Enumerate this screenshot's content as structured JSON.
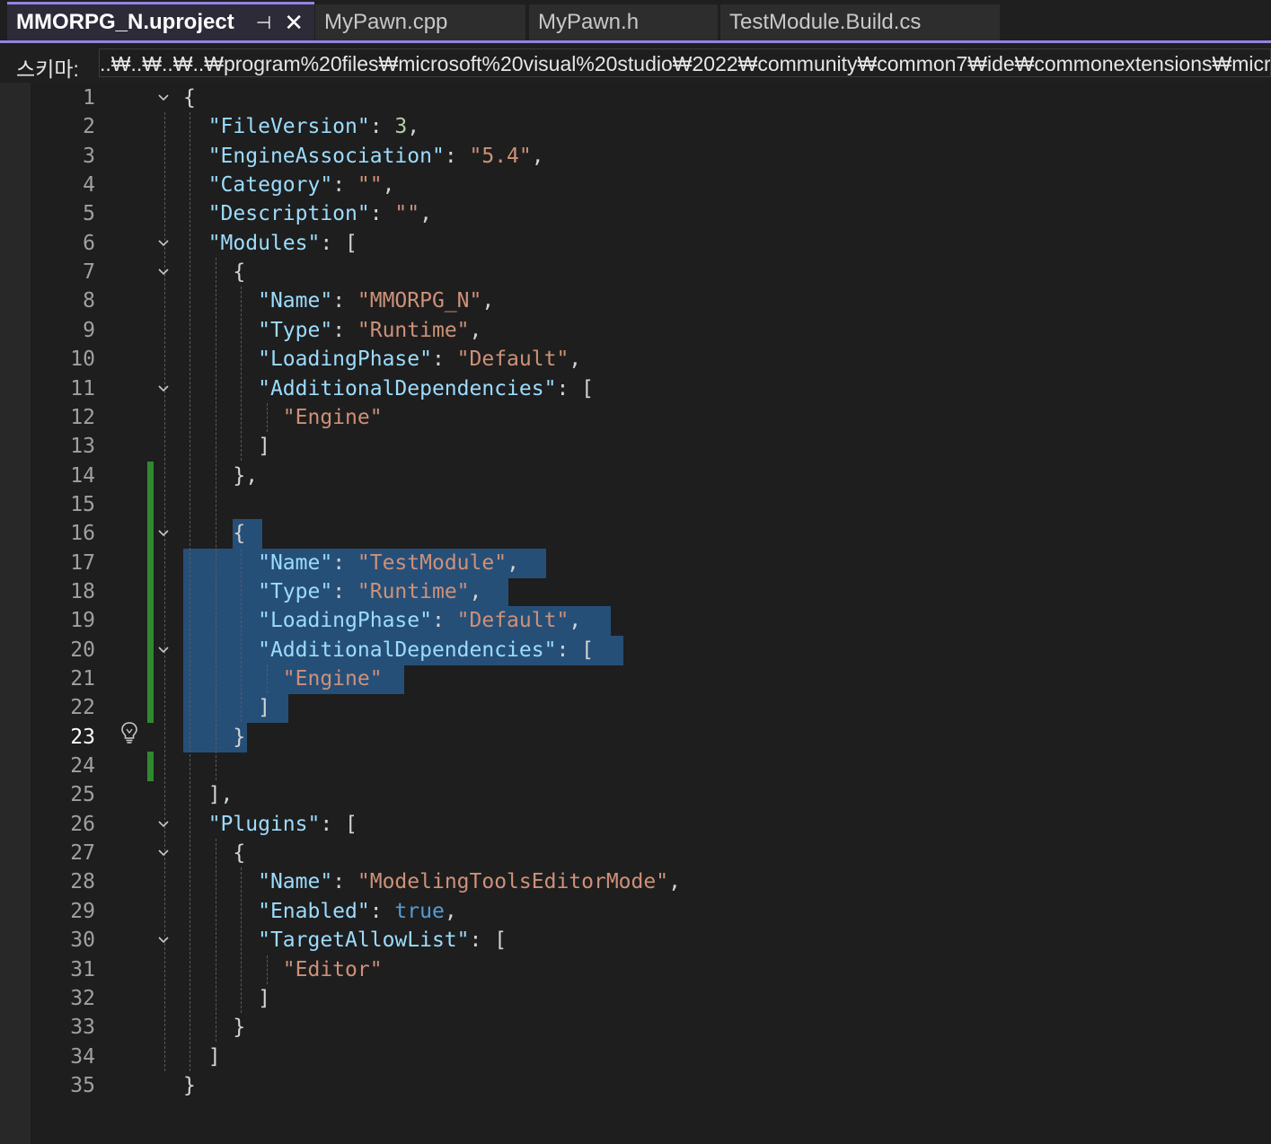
{
  "tabs": [
    {
      "label": "MMORPG_N.uproject",
      "active": true
    },
    {
      "label": "MyPawn.cpp",
      "active": false
    },
    {
      "label": "MyPawn.h",
      "active": false
    },
    {
      "label": "TestModule.Build.cs",
      "active": false
    }
  ],
  "tab_icons": {
    "pin": "⊣",
    "close": "✕"
  },
  "schema": {
    "label": "스키마:",
    "path": "..₩..₩..₩..₩program%20files₩microsoft%20visual%20studio₩2022₩community₩common7₩ide₩commonextensions₩micr"
  },
  "editor": {
    "current_line": 23,
    "line_numbers": [
      "1",
      "2",
      "3",
      "4",
      "5",
      "6",
      "7",
      "8",
      "9",
      "10",
      "11",
      "12",
      "13",
      "14",
      "15",
      "16",
      "17",
      "18",
      "19",
      "20",
      "21",
      "22",
      "23",
      "24",
      "25",
      "26",
      "27",
      "28",
      "29",
      "30",
      "31",
      "32",
      "33",
      "34",
      "35"
    ],
    "lines": [
      [
        [
          "p",
          "{"
        ]
      ],
      [
        [
          "p",
          "  "
        ],
        [
          "k",
          "\"FileVersion\""
        ],
        [
          "p",
          ": "
        ],
        [
          "n",
          "3"
        ],
        [
          "p",
          ","
        ]
      ],
      [
        [
          "p",
          "  "
        ],
        [
          "k",
          "\"EngineAssociation\""
        ],
        [
          "p",
          ": "
        ],
        [
          "s",
          "\"5.4\""
        ],
        [
          "p",
          ","
        ]
      ],
      [
        [
          "p",
          "  "
        ],
        [
          "k",
          "\"Category\""
        ],
        [
          "p",
          ": "
        ],
        [
          "s",
          "\"\""
        ],
        [
          "p",
          ","
        ]
      ],
      [
        [
          "p",
          "  "
        ],
        [
          "k",
          "\"Description\""
        ],
        [
          "p",
          ": "
        ],
        [
          "s",
          "\"\""
        ],
        [
          "p",
          ","
        ]
      ],
      [
        [
          "p",
          "  "
        ],
        [
          "k",
          "\"Modules\""
        ],
        [
          "p",
          ": ["
        ]
      ],
      [
        [
          "p",
          "    {"
        ]
      ],
      [
        [
          "p",
          "      "
        ],
        [
          "k",
          "\"Name\""
        ],
        [
          "p",
          ": "
        ],
        [
          "s",
          "\"MMORPG_N\""
        ],
        [
          "p",
          ","
        ]
      ],
      [
        [
          "p",
          "      "
        ],
        [
          "k",
          "\"Type\""
        ],
        [
          "p",
          ": "
        ],
        [
          "s",
          "\"Runtime\""
        ],
        [
          "p",
          ","
        ]
      ],
      [
        [
          "p",
          "      "
        ],
        [
          "k",
          "\"LoadingPhase\""
        ],
        [
          "p",
          ": "
        ],
        [
          "s",
          "\"Default\""
        ],
        [
          "p",
          ","
        ]
      ],
      [
        [
          "p",
          "      "
        ],
        [
          "k",
          "\"AdditionalDependencies\""
        ],
        [
          "p",
          ": ["
        ]
      ],
      [
        [
          "p",
          "        "
        ],
        [
          "s",
          "\"Engine\""
        ]
      ],
      [
        [
          "p",
          "      ]"
        ]
      ],
      [
        [
          "p",
          "    },"
        ]
      ],
      [
        [
          "p",
          ""
        ]
      ],
      [
        [
          "p",
          "    {"
        ]
      ],
      [
        [
          "p",
          "      "
        ],
        [
          "k",
          "\"Name\""
        ],
        [
          "p",
          ": "
        ],
        [
          "s",
          "\"TestModule\""
        ],
        [
          "p",
          ","
        ]
      ],
      [
        [
          "p",
          "      "
        ],
        [
          "k",
          "\"Type\""
        ],
        [
          "p",
          ": "
        ],
        [
          "s",
          "\"Runtime\""
        ],
        [
          "p",
          ","
        ]
      ],
      [
        [
          "p",
          "      "
        ],
        [
          "k",
          "\"LoadingPhase\""
        ],
        [
          "p",
          ": "
        ],
        [
          "s",
          "\"Default\""
        ],
        [
          "p",
          ","
        ]
      ],
      [
        [
          "p",
          "      "
        ],
        [
          "k",
          "\"AdditionalDependencies\""
        ],
        [
          "p",
          ": ["
        ]
      ],
      [
        [
          "p",
          "        "
        ],
        [
          "s",
          "\"Engine\""
        ]
      ],
      [
        [
          "p",
          "      ]"
        ]
      ],
      [
        [
          "p",
          "    }"
        ]
      ],
      [
        [
          "p",
          ""
        ]
      ],
      [
        [
          "p",
          "  ],"
        ]
      ],
      [
        [
          "p",
          "  "
        ],
        [
          "k",
          "\"Plugins\""
        ],
        [
          "p",
          ": ["
        ]
      ],
      [
        [
          "p",
          "    {"
        ]
      ],
      [
        [
          "p",
          "      "
        ],
        [
          "k",
          "\"Name\""
        ],
        [
          "p",
          ": "
        ],
        [
          "s",
          "\"ModelingToolsEditorMode\""
        ],
        [
          "p",
          ","
        ]
      ],
      [
        [
          "p",
          "      "
        ],
        [
          "k",
          "\"Enabled\""
        ],
        [
          "p",
          ": "
        ],
        [
          "b",
          "true"
        ],
        [
          "p",
          ","
        ]
      ],
      [
        [
          "p",
          "      "
        ],
        [
          "k",
          "\"TargetAllowList\""
        ],
        [
          "p",
          ": ["
        ]
      ],
      [
        [
          "p",
          "        "
        ],
        [
          "s",
          "\"Editor\""
        ]
      ],
      [
        [
          "p",
          "      ]"
        ]
      ],
      [
        [
          "p",
          "    }"
        ]
      ],
      [
        [
          "p",
          "  ]"
        ]
      ],
      [
        [
          "p",
          "}"
        ]
      ]
    ],
    "foldable_lines": [
      1,
      6,
      7,
      11,
      16,
      20,
      26,
      27,
      30
    ],
    "changed_lines": [
      14,
      15,
      16,
      17,
      18,
      19,
      20,
      21,
      22,
      24
    ],
    "selected_lines": [
      16,
      17,
      18,
      19,
      20,
      21,
      22,
      23
    ]
  },
  "colors": {
    "accent": "#9184e0",
    "selection": "#264f78",
    "change_bar": "#2f8a2f",
    "key": "#9cdcfe",
    "string": "#ce9178",
    "number": "#b5cea8",
    "boolean": "#569cd6"
  },
  "icons": {
    "fold": "chevron-down-icon",
    "lightbulb": "lightbulb-icon"
  }
}
